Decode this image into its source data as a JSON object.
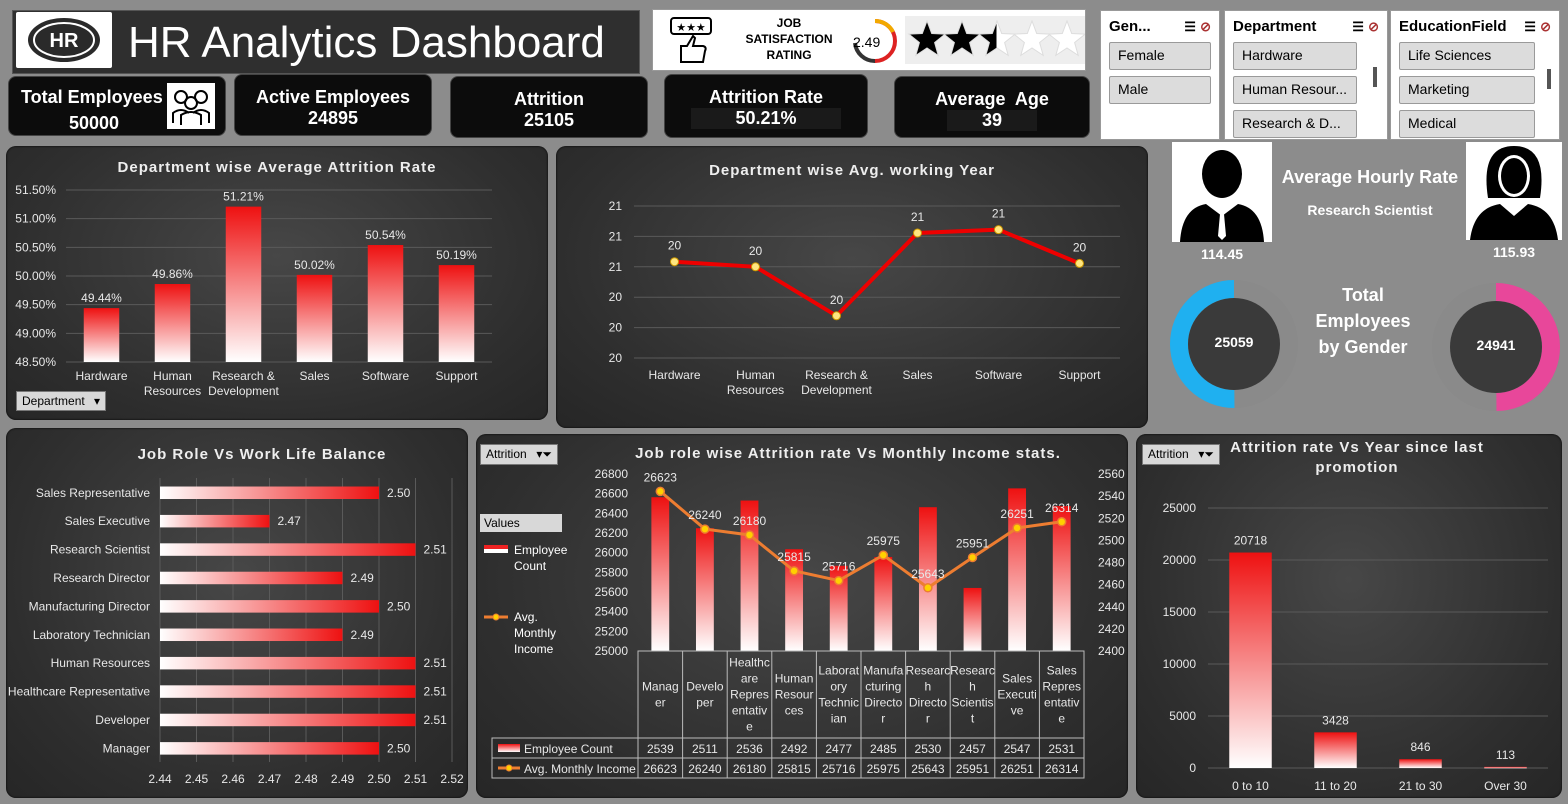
{
  "header": {
    "logo_text": "HR",
    "title": "HR Analytics Dashboard"
  },
  "job_satisfaction": {
    "label_line1": "JOB",
    "label_line2": "SATISFACTION",
    "label_line3": "RATING",
    "value": "2.49",
    "stars_filled": 2.49,
    "stars_total": 5
  },
  "kpis": {
    "total_employees": {
      "label": "Total Employees",
      "value": "50000"
    },
    "active_employees": {
      "label": "Active Employees",
      "value": "24895"
    },
    "attrition": {
      "label": "Attrition",
      "value": "25105"
    },
    "attrition_rate": {
      "label": "Attrition Rate",
      "value": "50.21%"
    },
    "average_age": {
      "label": "Average  Age",
      "value": "39"
    }
  },
  "slicers": {
    "gender": {
      "title": "Gen...",
      "items": [
        "Female",
        "Male"
      ]
    },
    "department": {
      "title": "Department",
      "items": [
        "Hardware",
        "Human Resour...",
        "Research & D..."
      ]
    },
    "education": {
      "title": "EducationField",
      "items": [
        "Life Sciences",
        "Marketing",
        "Medical"
      ]
    }
  },
  "hourly": {
    "title": "Average Hourly Rate",
    "role": "Research Scientist",
    "male_value": "114.45",
    "female_value": "115.93"
  },
  "gender_totals": {
    "label_line1": "Total",
    "label_line2": "Employees",
    "label_line3": "by Gender",
    "male": "25059",
    "female": "24941",
    "male_share": 0.5012,
    "female_share": 0.4988,
    "male_color": "#1fb0f0",
    "female_color": "#e8479a"
  },
  "dropdowns": {
    "department": "Department",
    "attrition_1": "Attrition",
    "attrition_2": "Attrition"
  },
  "combo_legend": {
    "title": "Values",
    "count": "Employee Count",
    "income_line1": "Avg.",
    "income_line2": "Monthly",
    "income_line3": "Income"
  },
  "chart_data": [
    {
      "id": "dept_attrition",
      "type": "bar",
      "title": "Department wise Average Attrition Rate",
      "categories": [
        "Hardware",
        "Human Resources",
        "Research & Development",
        "Sales",
        "Software",
        "Support"
      ],
      "values": [
        49.44,
        49.86,
        51.21,
        50.02,
        50.54,
        50.19
      ],
      "value_labels": [
        "49.44%",
        "49.86%",
        "51.21%",
        "50.02%",
        "50.54%",
        "50.19%"
      ],
      "ylim": [
        48.5,
        51.5
      ],
      "yticks": [
        "48.50%",
        "49.00%",
        "49.50%",
        "50.00%",
        "50.50%",
        "51.00%",
        "51.50%"
      ],
      "grid": true
    },
    {
      "id": "dept_working_year",
      "type": "line",
      "title": "Department wise Avg. working Year",
      "categories": [
        "Hardware",
        "Human Resources",
        "Research & Development",
        "Sales",
        "Software",
        "Support"
      ],
      "values": [
        20.47,
        20.44,
        20.15,
        20.64,
        20.66,
        20.46
      ],
      "value_labels": [
        "20",
        "20",
        "20",
        "21",
        "21",
        "20"
      ],
      "ylim": [
        19.9,
        20.8
      ],
      "yticks": [
        "20",
        "20",
        "20",
        "21",
        "21",
        "21"
      ],
      "grid": true
    },
    {
      "id": "work_life",
      "type": "bar",
      "orientation": "horizontal",
      "title": "Job Role Vs Work Life Balance",
      "categories": [
        "Sales Representative",
        "Sales Executive",
        "Research Scientist",
        "Research Director",
        "Manufacturing Director",
        "Laboratory Technician",
        "Human Resources",
        "Healthcare Representative",
        "Developer",
        "Manager"
      ],
      "values": [
        2.5,
        2.47,
        2.51,
        2.49,
        2.5,
        2.49,
        2.51,
        2.51,
        2.51,
        2.5
      ],
      "value_labels": [
        "2.50",
        "2.47",
        "2.51",
        "2.49",
        "2.50",
        "2.49",
        "2.51",
        "2.51",
        "2.51",
        "2.50"
      ],
      "xlim": [
        2.44,
        2.52
      ],
      "xticks": [
        "2.44",
        "2.45",
        "2.46",
        "2.47",
        "2.48",
        "2.49",
        "2.50",
        "2.51",
        "2.52"
      ],
      "grid": true
    },
    {
      "id": "role_attrition_income",
      "type": "bar",
      "title": "Job role wise Attrition rate Vs Monthly Income stats.",
      "categories": [
        "Manager",
        "Developer",
        "Healthcare Representative",
        "Human Resources",
        "Laboratory Technician",
        "Manufacturing Director",
        "Research Director",
        "Research Scientist",
        "Sales Executive",
        "Sales Representative"
      ],
      "table_categories": [
        "Manag er",
        "Develo per",
        "Healthc are Repres entativ e",
        "Human Resour ces",
        "Laborat ory Technic ian",
        "Manufa cturing Directo r",
        "Researc h Directo r",
        "Researc h Scientis t",
        "Sales Executi ve",
        "Sales Repres entativ e"
      ],
      "series": [
        {
          "name": "Employee Count",
          "values": [
            2539,
            2511,
            2536,
            2492,
            2477,
            2485,
            2530,
            2457,
            2547,
            2531
          ],
          "axis": "right"
        },
        {
          "name": "Avg. Monthly Income",
          "values": [
            26623,
            26240,
            26180,
            25815,
            25716,
            25975,
            25643,
            25951,
            26251,
            26314
          ],
          "axis": "left",
          "type": "line"
        }
      ],
      "ylim_left": [
        25000,
        26800
      ],
      "yticks_left": [
        "25000",
        "25200",
        "25400",
        "25600",
        "25800",
        "26000",
        "26200",
        "26400",
        "26600",
        "26800"
      ],
      "ylim_right": [
        2400,
        2560
      ],
      "yticks_right": [
        "2400",
        "2420",
        "2440",
        "2460",
        "2480",
        "2500",
        "2520",
        "2540",
        "2560"
      ],
      "line_color": "#ed7d31"
    },
    {
      "id": "promotion",
      "type": "bar",
      "title_line1": "Attrition rate Vs Year since last",
      "title_line2": "promotion",
      "categories": [
        "0 to 10",
        "11 to 20",
        "21 to 30",
        "Over 30"
      ],
      "values": [
        20718,
        3428,
        846,
        113
      ],
      "value_labels": [
        "20718",
        "3428",
        "846",
        "113"
      ],
      "ylim": [
        0,
        25000
      ],
      "yticks": [
        "0",
        "5000",
        "10000",
        "15000",
        "20000",
        "25000"
      ],
      "grid": true
    }
  ]
}
